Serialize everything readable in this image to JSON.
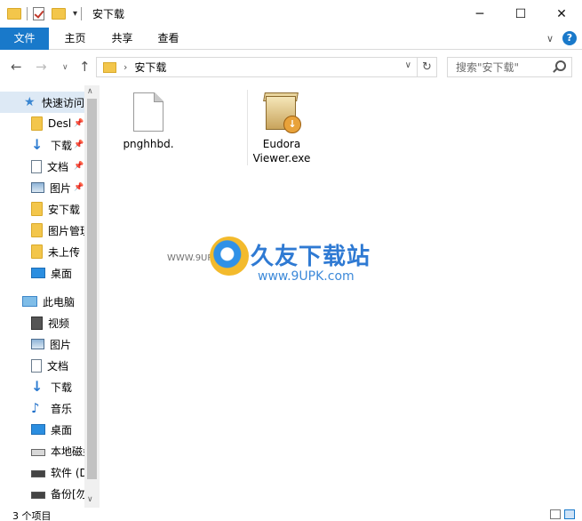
{
  "window": {
    "title": "安下载",
    "minimize": "─",
    "maximize": "☐",
    "close": "✕"
  },
  "ribbon": {
    "tabs": [
      "文件",
      "主页",
      "共享",
      "查看"
    ]
  },
  "address": {
    "path": "安下载",
    "search_placeholder": "搜索\"安下载\""
  },
  "sidebar": {
    "items": [
      {
        "label": "快速访问",
        "icon": "star-icon",
        "selected": true
      },
      {
        "label": "Desl",
        "icon": "folder-icon",
        "pinned": true
      },
      {
        "label": "下载",
        "icon": "download-icon",
        "pinned": true
      },
      {
        "label": "文档",
        "icon": "document-icon",
        "pinned": true
      },
      {
        "label": "图片",
        "icon": "picture-icon",
        "pinned": true
      },
      {
        "label": "安下载",
        "icon": "folder-icon"
      },
      {
        "label": "图片管理",
        "icon": "folder-icon"
      },
      {
        "label": "未上传",
        "icon": "folder-icon"
      },
      {
        "label": "桌面",
        "icon": "desktop-icon"
      },
      {
        "label": "此电脑",
        "icon": "computer-icon"
      },
      {
        "label": "视频",
        "icon": "video-icon"
      },
      {
        "label": "图片",
        "icon": "picture-icon"
      },
      {
        "label": "文档",
        "icon": "document-icon"
      },
      {
        "label": "下载",
        "icon": "download-icon"
      },
      {
        "label": "音乐",
        "icon": "music-icon"
      },
      {
        "label": "桌面",
        "icon": "desktop-icon"
      },
      {
        "label": "本地磁盘",
        "icon": "drive-icon"
      },
      {
        "label": "软件 (D",
        "icon": "drive-icon"
      },
      {
        "label": "备份[勿",
        "icon": "drive-icon"
      }
    ]
  },
  "files": [
    {
      "name": "pnghhbd.",
      "icon": "blank-file-icon"
    },
    {
      "name": "Eudora Viewer.exe",
      "line1": "Eudora",
      "line2": "Viewer.exe",
      "icon": "installer-icon"
    }
  ],
  "watermark": {
    "title": "久友下载站",
    "subtitle": "www.9UPK.com",
    "small": "WWW.9UPK.COM"
  },
  "status": {
    "count": "3 个项目"
  }
}
